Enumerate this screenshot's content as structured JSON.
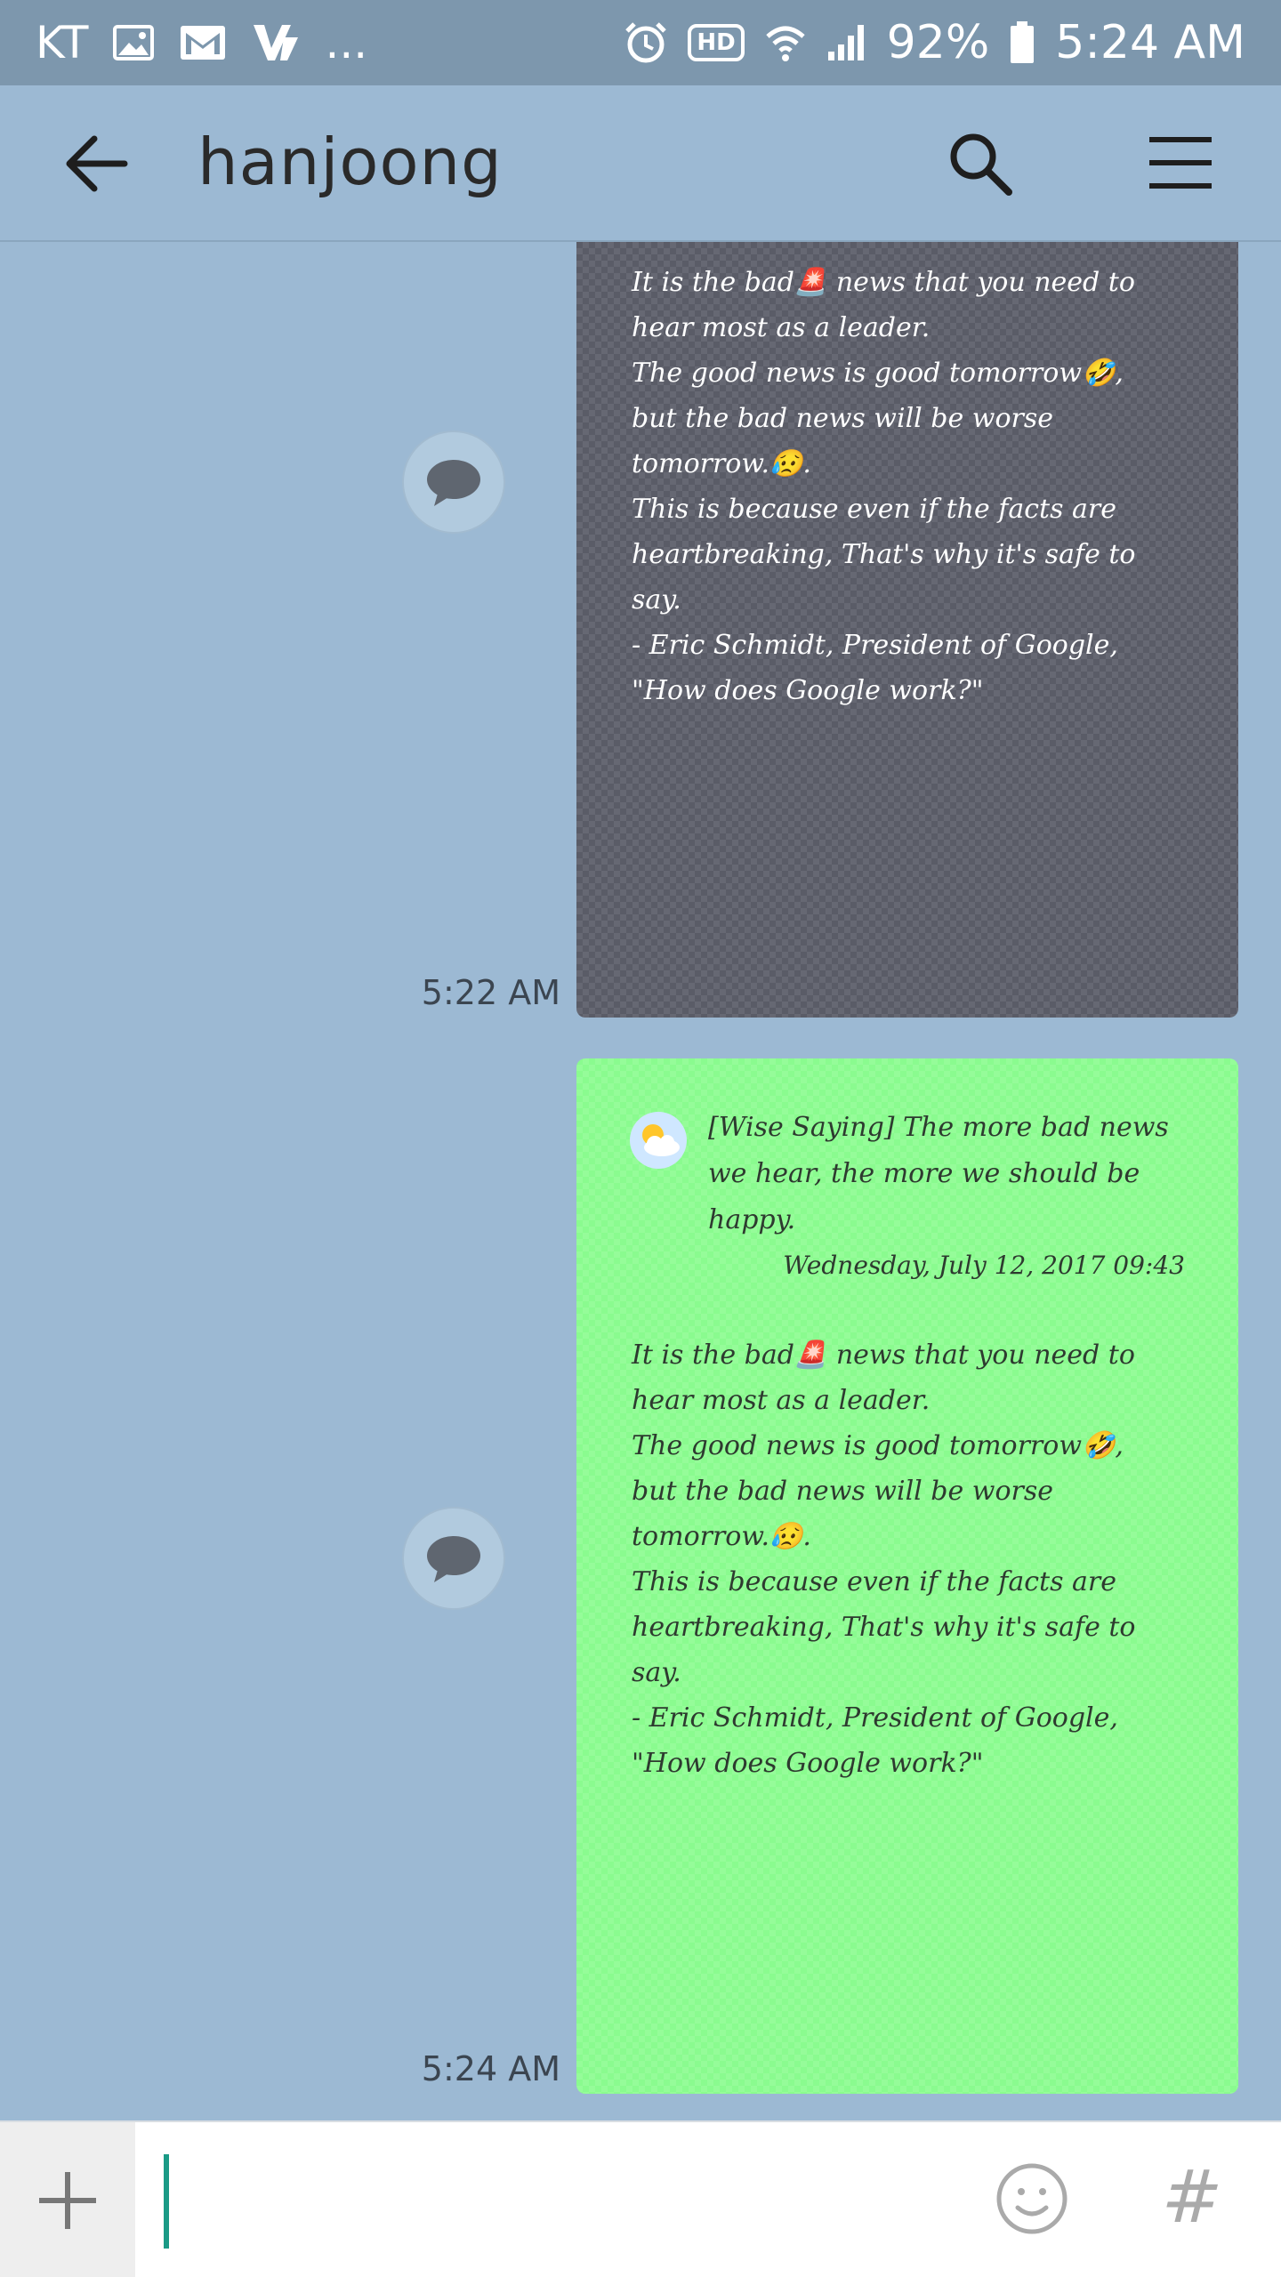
{
  "status_bar": {
    "carrier": "KT",
    "dots": "...",
    "hd_badge": "HD",
    "battery_percent": "92%",
    "time": "5:24 AM"
  },
  "header": {
    "title": "hanjoong"
  },
  "messages": [
    {
      "body": "It is the bad🚨 news that you need to\nhear most as a leader.\nThe good news is good tomorrow🤣,\nbut the bad news will be worse\ntomorrow.😥.\nThis is because even if the facts are\nheartbreaking, That's why it's safe to\nsay.\n- Eric Schmidt, President of Google,\n\"How does Google work?\"",
      "time": "5:22 AM"
    },
    {
      "news_title": "[Wise Saying] The more bad news we hear, the more we should be happy.",
      "news_date": "Wednesday, July 12, 2017 09:43",
      "body": "It is the bad🚨 news that you need to\nhear most as a leader.\nThe good news is good tomorrow🤣,\nbut the bad news will be worse\ntomorrow.😥.\nThis is because even if the facts are\nheartbreaking, That's why it's safe to\nsay.\n- Eric Schmidt, President of Google,\n\"How does Google work?\"",
      "time": "5:24 AM"
    }
  ],
  "input_bar": {
    "value": "",
    "hash_label": "#"
  },
  "colors": {
    "background": "#9cb9d3",
    "status_bar": "#7d97ad",
    "gray_note": "#5a5c67",
    "green_note": "#8afb8f",
    "caret": "#1a9a86"
  },
  "icons": [
    "image-icon",
    "gmail-icon",
    "v-app-icon",
    "alarm-icon",
    "wifi-icon",
    "signal-icon",
    "battery-icon",
    "back-arrow-icon",
    "search-icon",
    "menu-icon",
    "share-bubble-icon",
    "weather-icon",
    "plus-icon",
    "emoji-icon"
  ]
}
